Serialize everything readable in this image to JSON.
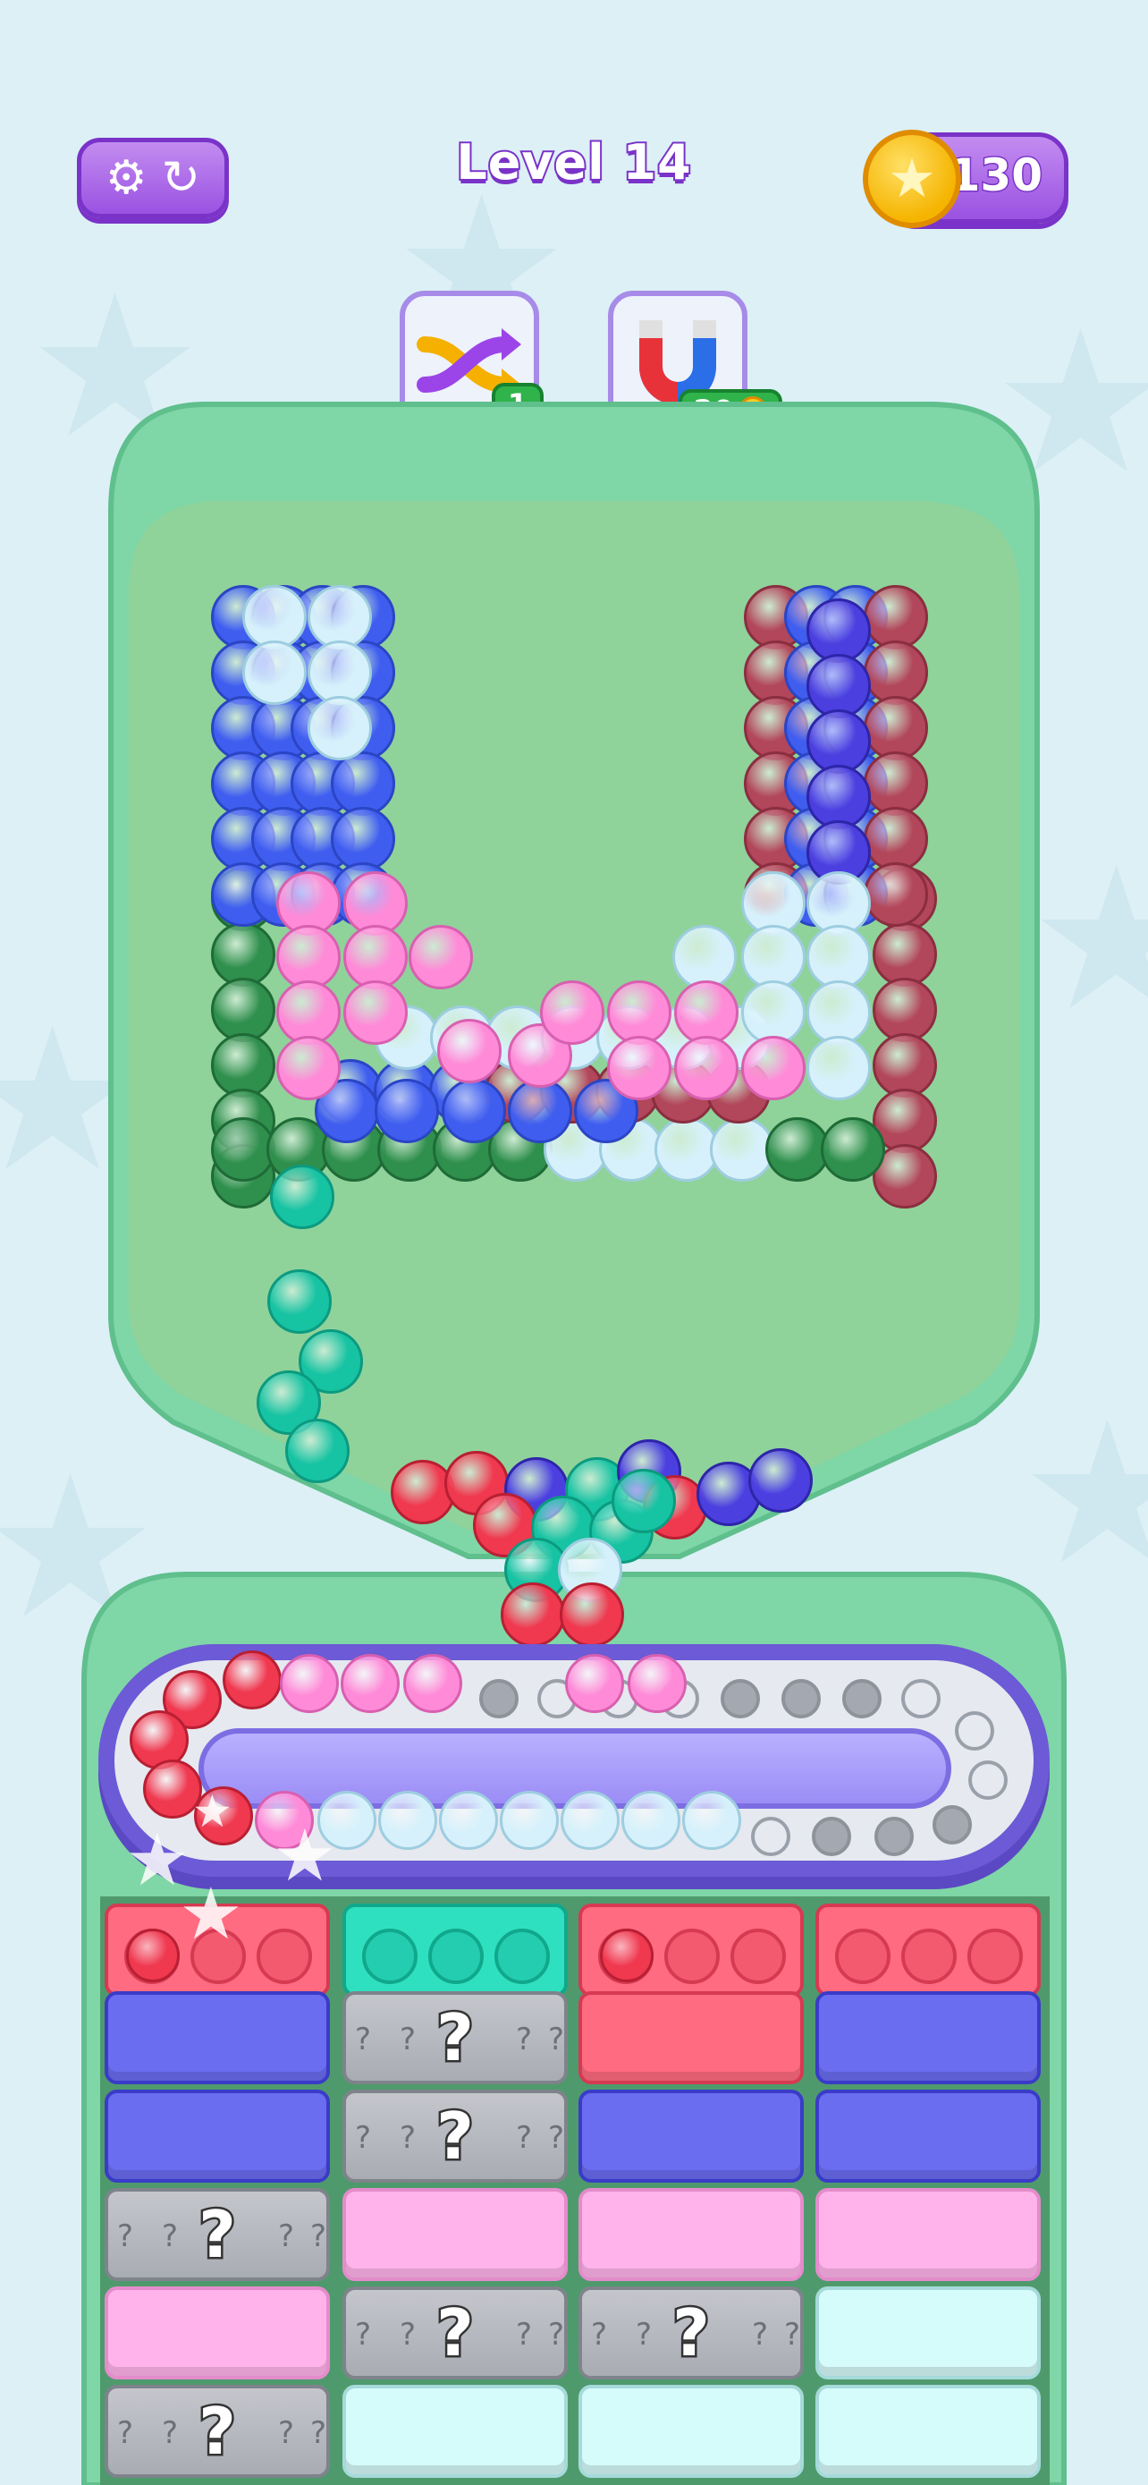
{
  "header": {
    "level_label": "Level 14",
    "coins": "130",
    "settings_icon": "gear-icon",
    "restart_icon": "restart-icon",
    "coin_icon": "star-coin-icon"
  },
  "boosters": [
    {
      "name": "shuffle",
      "icon": "shuffle-arrows-icon",
      "count": "1"
    },
    {
      "name": "magnet",
      "icon": "magnet-icon",
      "cost": "20"
    }
  ],
  "tile_grid": {
    "columns": [
      [
        "red-cup",
        "blue",
        "blue",
        "mystery",
        "pink",
        "mystery"
      ],
      [
        "teal-cup",
        "mystery",
        "mystery",
        "pink",
        "mystery",
        "lightblue"
      ],
      [
        "red-cup",
        "red",
        "blue",
        "pink",
        "mystery",
        "lightblue"
      ],
      [
        "red-cup",
        "blue",
        "blue",
        "pink",
        "lightblue",
        "lightblue"
      ]
    ],
    "mystery_symbol": "?"
  },
  "colors": {
    "background": "#dcf0f6",
    "board_rim": "#7fd6a6",
    "board_floor": "#8fd39a",
    "accent_purple": "#9a52e2",
    "blue": "#3f5ef0",
    "lightblue": "#d6f1fb",
    "pink": "#ff8ad8",
    "maroon": "#b2465a",
    "darkgreen": "#2f8f4d",
    "teal": "#16c3a3",
    "red": "#f0384f",
    "royal": "#4b3fe0"
  }
}
